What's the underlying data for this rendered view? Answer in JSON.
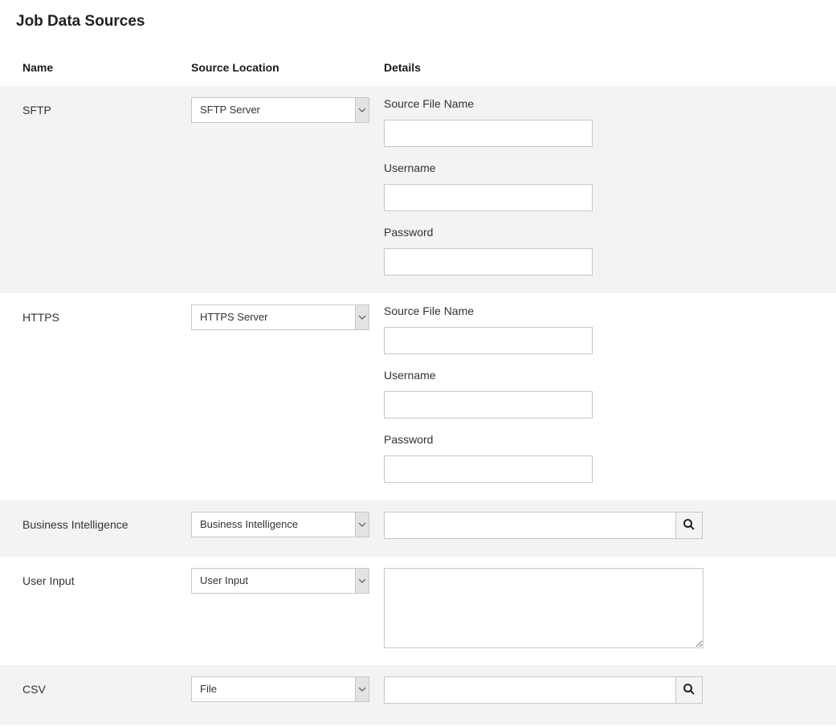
{
  "title": "Job Data Sources",
  "headers": {
    "name": "Name",
    "source_location": "Source Location",
    "details": "Details"
  },
  "rows": {
    "sftp": {
      "name": "SFTP",
      "select_value": "SFTP Server",
      "fields": {
        "source_file_name": {
          "label": "Source File Name",
          "value": ""
        },
        "username": {
          "label": "Username",
          "value": ""
        },
        "password": {
          "label": "Password",
          "value": ""
        }
      }
    },
    "https": {
      "name": "HTTPS",
      "select_value": "HTTPS Server",
      "fields": {
        "source_file_name": {
          "label": "Source File Name",
          "value": ""
        },
        "username": {
          "label": "Username",
          "value": ""
        },
        "password": {
          "label": "Password",
          "value": ""
        }
      }
    },
    "bi": {
      "name": "Business Intelligence",
      "select_value": "Business Intelligence",
      "search_value": ""
    },
    "user_input": {
      "name": "User Input",
      "select_value": "User Input",
      "textarea_value": ""
    },
    "csv": {
      "name": "CSV",
      "select_value": "File",
      "search_value": ""
    }
  }
}
